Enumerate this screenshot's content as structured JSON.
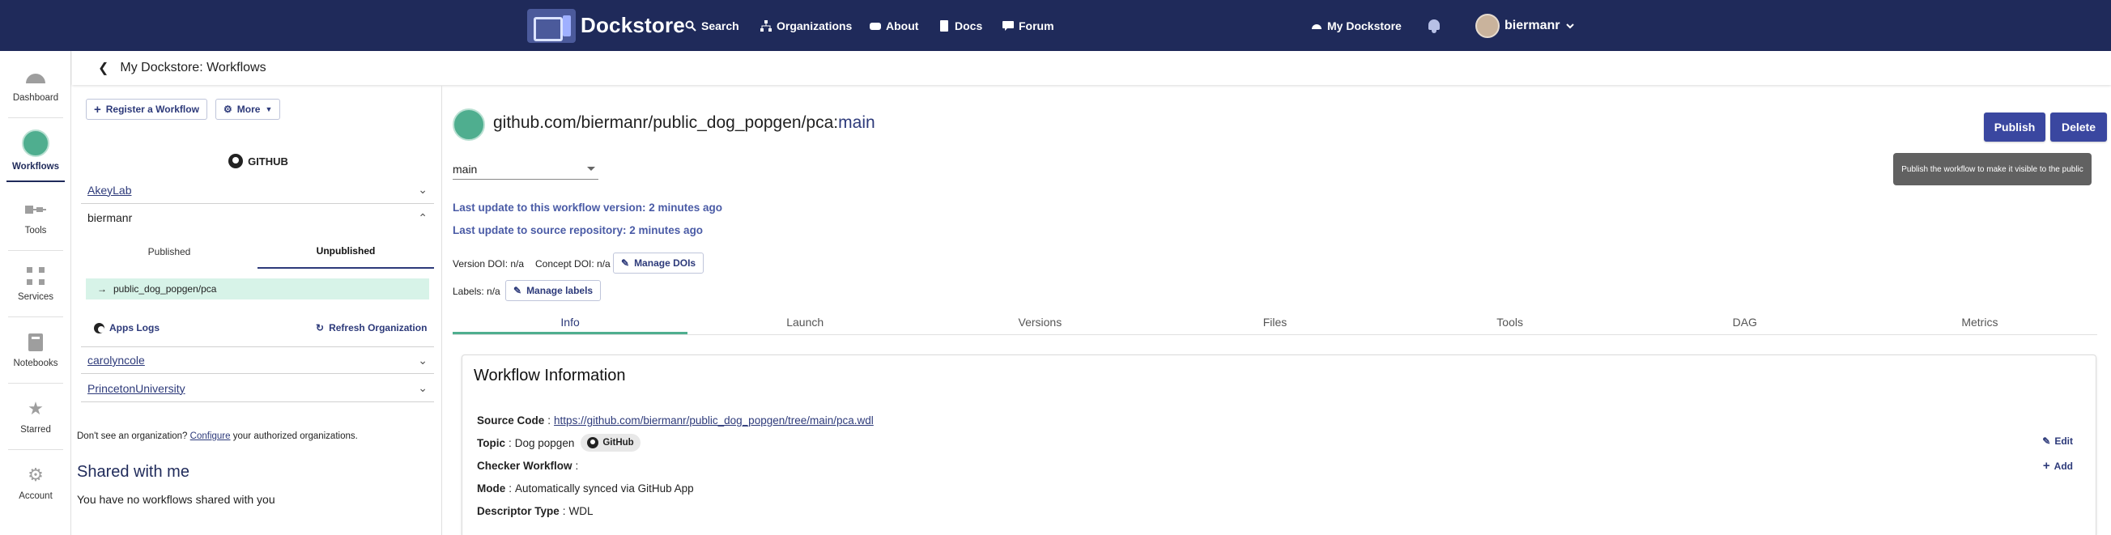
{
  "topbar": {
    "brand": "Dockstore",
    "nav": [
      {
        "label": "Search",
        "icon": "search-icon"
      },
      {
        "label": "Organizations",
        "icon": "organizations-icon"
      },
      {
        "label": "About",
        "icon": "about-icon"
      },
      {
        "label": "Docs",
        "icon": "docs-icon"
      },
      {
        "label": "Forum",
        "icon": "forum-icon"
      }
    ],
    "my_dockstore": "My Dockstore",
    "username": "biermanr"
  },
  "rail": [
    {
      "label": "Dashboard",
      "icon": "dashboard-icon"
    },
    {
      "label": "Workflows",
      "icon": "workflows-icon"
    },
    {
      "label": "Tools",
      "icon": "tools-icon"
    },
    {
      "label": "Services",
      "icon": "services-icon"
    },
    {
      "label": "Notebooks",
      "icon": "notebooks-icon"
    },
    {
      "label": "Starred",
      "icon": "star-icon"
    },
    {
      "label": "Account",
      "icon": "gear-icon"
    }
  ],
  "breadcrumb": {
    "title": "My Dockstore: Workflows"
  },
  "left": {
    "register_button": "Register a Workflow",
    "more_button": "More",
    "source_heading": "GITHUB",
    "orgs": [
      "AkeyLab",
      "carolyncole",
      "PrincetonUniversity"
    ],
    "expanded_org": "biermanr",
    "subtabs": [
      "Published",
      "Unpublished"
    ],
    "workflow_item": "public_dog_popgen/pca",
    "apps_logs": "Apps Logs",
    "refresh_org": "Refresh Organization",
    "help_prefix": "Don't see an organization?",
    "help_link": "Configure",
    "help_suffix": "your authorized organizations.",
    "shared_heading": "Shared with me",
    "shared_empty": "You have no workflows shared with you"
  },
  "main": {
    "title_path": "github.com/biermanr/public_dog_popgen/pca",
    "title_sep": ":",
    "title_version": "main",
    "publish": "Publish",
    "delete": "Delete",
    "tooltip": "Publish the workflow to make it visible to the public",
    "version_select": "main",
    "last_update_version": "Last update to this workflow version: 2 minutes ago",
    "last_update_repo": "Last update to source repository: 2 minutes ago",
    "version_doi": "Version DOI: n/a",
    "concept_doi": "Concept DOI: n/a",
    "manage_dois": "Manage DOIs",
    "labels": "Labels: n/a",
    "manage_labels": "Manage labels",
    "tabs": [
      "Info",
      "Launch",
      "Versions",
      "Files",
      "Tools",
      "DAG",
      "Metrics"
    ],
    "card": {
      "heading": "Workflow Information",
      "source_code_label": "Source Code",
      "source_code_url": "https://github.com/biermanr/public_dog_popgen/tree/main/pca.wdl",
      "topic_label": "Topic",
      "topic_value": "Dog popgen",
      "topic_tag": "GitHub",
      "checker_label": "Checker Workflow",
      "mode_label": "Mode",
      "mode_value": "Automatically synced via GitHub App",
      "descriptor_label": "Descriptor Type",
      "descriptor_value": "WDL",
      "edit": "Edit",
      "add": "Add"
    }
  }
}
